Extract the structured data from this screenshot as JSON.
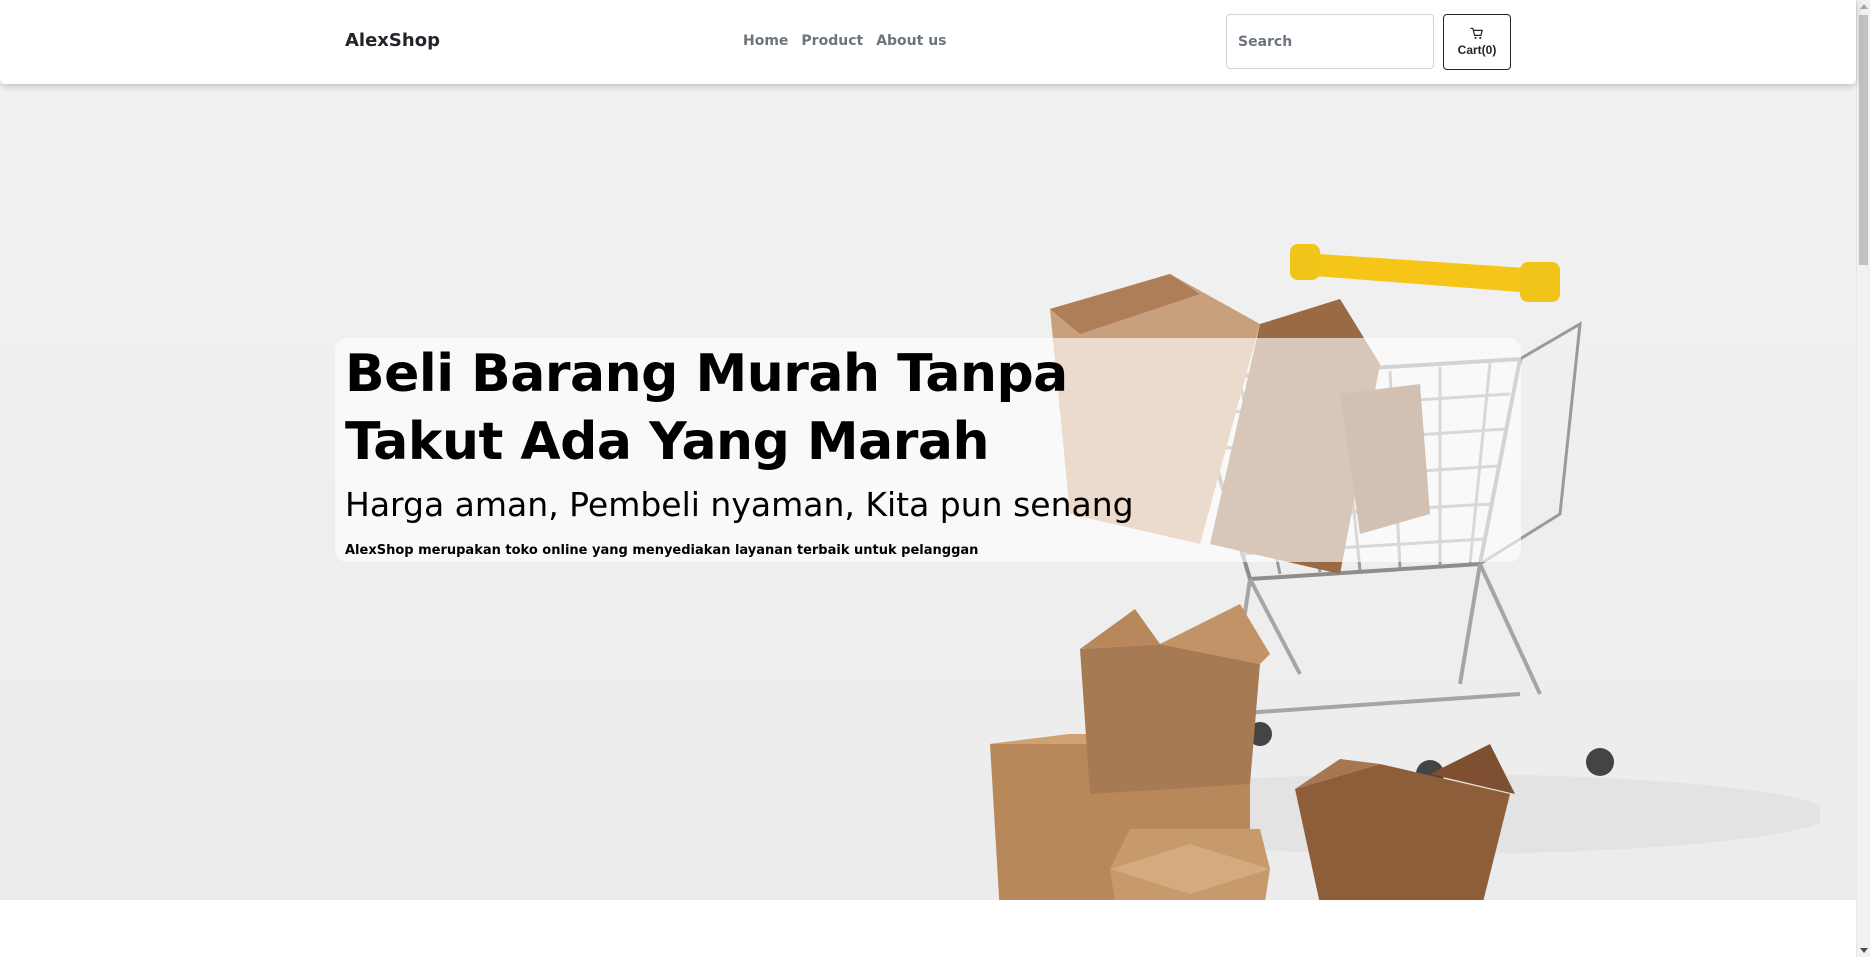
{
  "navbar": {
    "brand": "AlexShop",
    "links": [
      {
        "label": "Home"
      },
      {
        "label": "Product"
      },
      {
        "label": "About us"
      }
    ],
    "search": {
      "placeholder": "Search",
      "value": ""
    },
    "cart": {
      "label": "Cart(0)",
      "icon": "cart-icon"
    }
  },
  "hero": {
    "title": "Beli Barang Murah Tanpa Takut Ada Yang Marah",
    "subtitle": "Harga aman, Pembeli nyaman, Kita pun senang",
    "description": "AlexShop merupakan toko online yang menyediakan layanan terbaik untuk pelanggan"
  },
  "colors": {
    "accent_cart_handle": "#f5c518",
    "box_brown": "#b98a5e",
    "text_dark": "#212529",
    "nav_link": "#6c757d"
  }
}
